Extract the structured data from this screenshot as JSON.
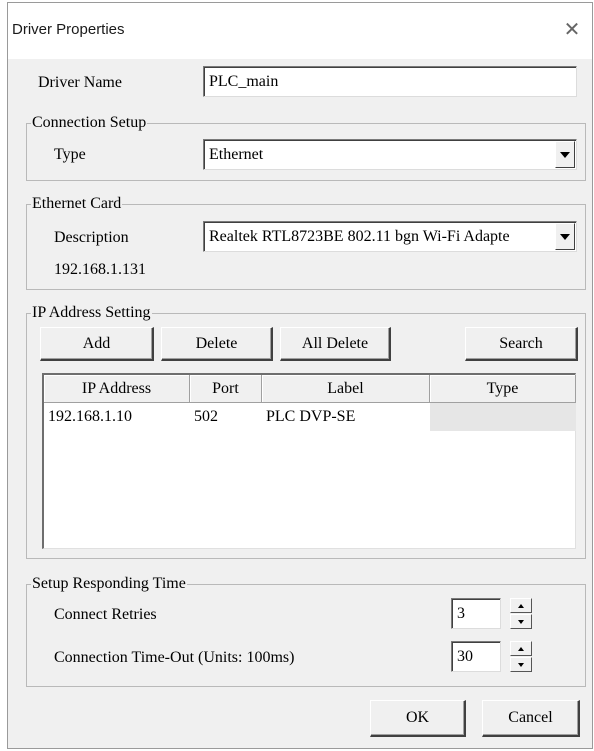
{
  "window": {
    "title": "Driver Properties"
  },
  "driver": {
    "label": "Driver Name",
    "value": "PLC_main"
  },
  "connection": {
    "group_title": "Connection Setup",
    "type_label": "Type",
    "type_value": "Ethernet"
  },
  "ethernet": {
    "group_title": "Ethernet Card",
    "description_label": "Description",
    "description_value": "Realtek RTL8723BE 802.11 bgn Wi-Fi Adapte",
    "ip": "192.168.1.131"
  },
  "ip_setting": {
    "group_title": "IP Address Setting",
    "buttons": {
      "add": "Add",
      "delete": "Delete",
      "all_delete": "All Delete",
      "search": "Search"
    },
    "columns": [
      "IP Address",
      "Port",
      "Label",
      "Type"
    ],
    "rows": [
      {
        "ip": "192.168.1.10",
        "port": "502",
        "label": "PLC DVP-SE",
        "type": ""
      }
    ]
  },
  "timing": {
    "group_title": "Setup Responding Time",
    "retries_label": "Connect Retries",
    "retries_value": "3",
    "timeout_label": "Connection Time-Out (Units: 100ms)",
    "timeout_value": "30"
  },
  "footer": {
    "ok": "OK",
    "cancel": "Cancel"
  }
}
